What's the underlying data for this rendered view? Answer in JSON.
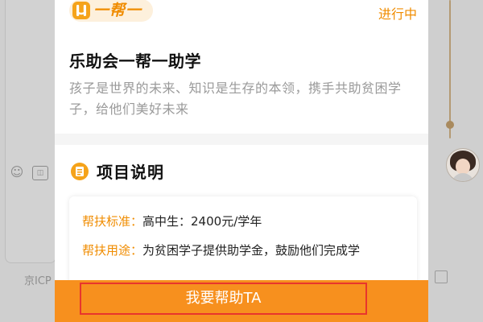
{
  "background": {
    "icp_text": "京ICP"
  },
  "project": {
    "tag_label": "一帮一",
    "status": "进行中",
    "title": "乐助会一帮一助学",
    "description_line1": "孩子是世界的未来、知识是生存的本领，携手共助贫困学",
    "description_line2": "子，给他们美好未来"
  },
  "section": {
    "title": "项目说明",
    "items": [
      {
        "label": "帮扶标准：",
        "value": "高中生：2400元/学年"
      },
      {
        "label": "帮扶用途：",
        "value": "为贫困学子提供助学金，鼓励他们完成学"
      }
    ]
  },
  "cta": {
    "label": "我要帮助TA"
  },
  "colors": {
    "accent": "#f08c00",
    "cta_bg": "#f7901e",
    "highlight_border": "#e8352d"
  }
}
